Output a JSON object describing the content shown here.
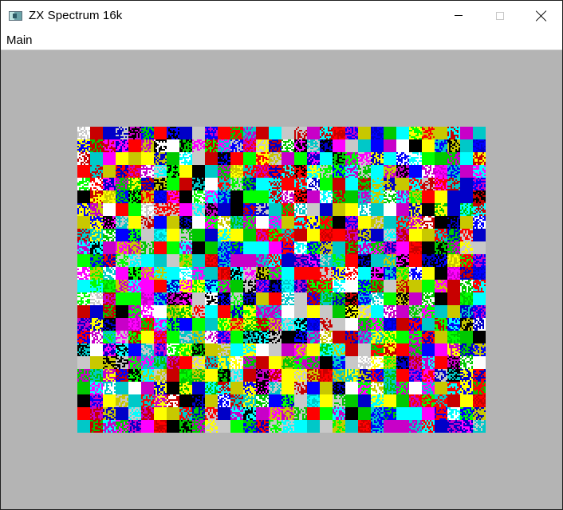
{
  "window": {
    "title": "ZX Spectrum 16k"
  },
  "menubar": {
    "items": [
      {
        "label": "Main"
      }
    ]
  },
  "display": {
    "border_color": "#b4b4b4",
    "palette": [
      "#000000",
      "#0000ff",
      "#ff0000",
      "#ff00ff",
      "#00ff00",
      "#00ffff",
      "#ffff00",
      "#ffffff",
      "#0000c8",
      "#c80000",
      "#c800c8",
      "#00c800",
      "#00c8c8",
      "#c8c800",
      "#c8c8c8"
    ],
    "content": "uninitialised screen memory (random attribute noise)"
  }
}
